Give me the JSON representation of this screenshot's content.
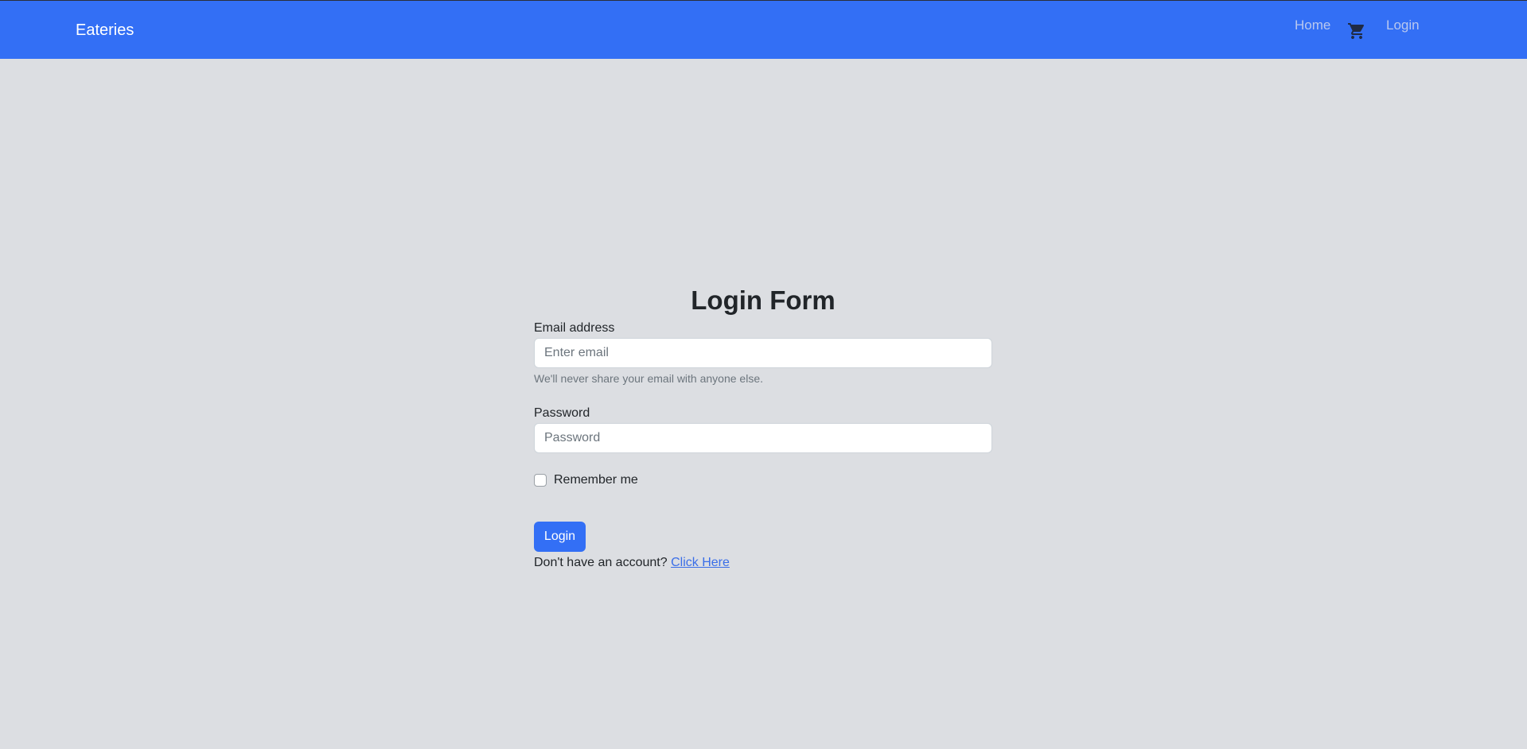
{
  "navbar": {
    "brand": "Eateries",
    "home_label": "Home",
    "cart_icon": "cart-icon",
    "login_label": "Login",
    "bg_color": "#336ff5"
  },
  "form": {
    "title": "Login Form",
    "email_label": "Email address",
    "email_placeholder": "Enter email",
    "email_value": "",
    "email_help": "We'll never share your email with anyone else.",
    "password_label": "Password",
    "password_placeholder": "Password",
    "password_value": "",
    "remember_label": "Remember me",
    "remember_checked": false,
    "submit_label": "Login",
    "signup_prompt": "Don't have an account?",
    "signup_link": "Click Here"
  }
}
